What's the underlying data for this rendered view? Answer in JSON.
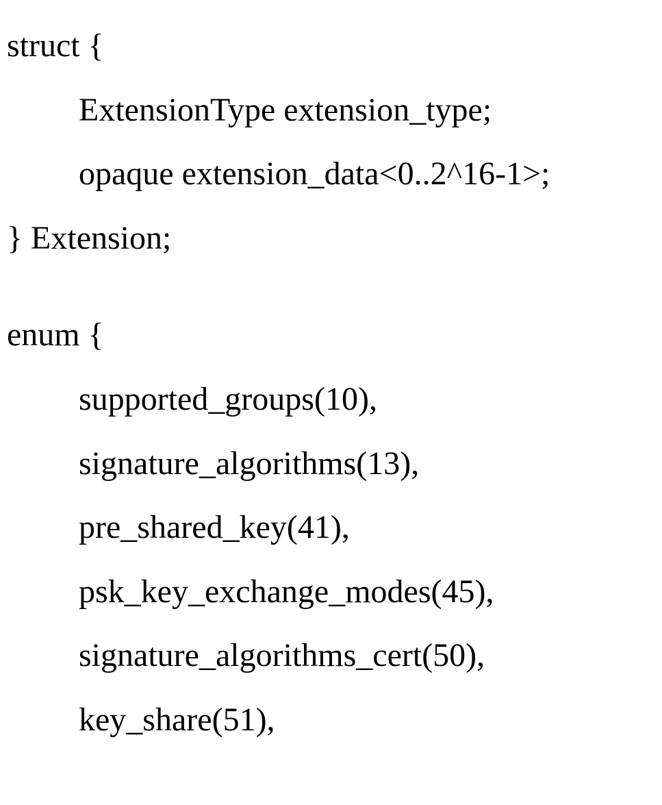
{
  "struct": {
    "open": "struct {",
    "field1": "ExtensionType extension_type;",
    "field2": "opaque extension_data<0..2^16-1>;",
    "close": "} Extension;"
  },
  "enum": {
    "open": "enum {",
    "items": [
      "supported_groups(10),",
      "signature_algorithms(13),",
      "pre_shared_key(41),",
      "psk_key_exchange_modes(45),",
      "signature_algorithms_cert(50),",
      "key_share(51),"
    ]
  }
}
